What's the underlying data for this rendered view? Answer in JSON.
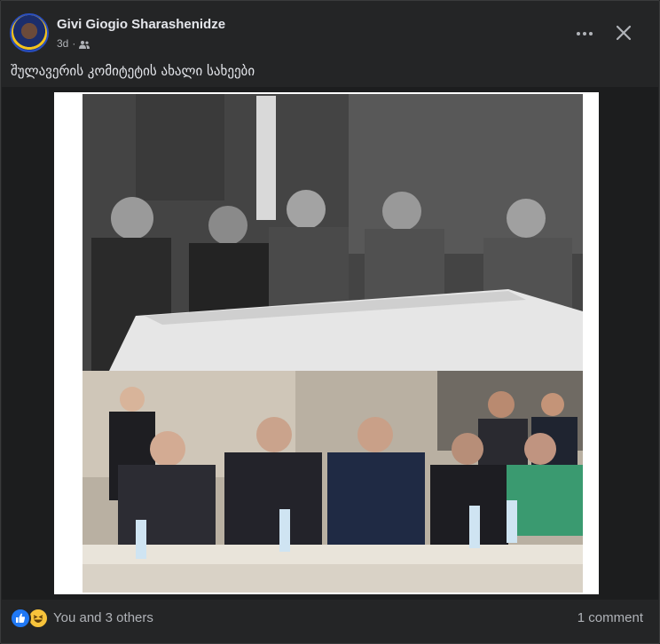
{
  "post": {
    "author": "Givi Giogio Sharashenidze",
    "timestamp": "3d",
    "separator": "·",
    "audience_icon": "friends-icon",
    "caption": "შულავერის კომიტეტის ახალი სახეები"
  },
  "header_actions": {
    "more_icon": "more-horizontal-icon",
    "close_icon": "close-icon"
  },
  "photo": {
    "top_half": "black-and-white-historical-photo",
    "bottom_half": "color-meeting-photo"
  },
  "footer": {
    "reactions": [
      "like-icon",
      "haha-icon"
    ],
    "reactions_label": "You and 3 others",
    "comments_label": "1 comment"
  },
  "colors": {
    "background": "#18191a",
    "card": "#242526",
    "text_primary": "#e4e6eb",
    "text_secondary": "#b0b3b8",
    "like_blue": "#2078f4",
    "haha_yellow": "#f7c33b"
  }
}
